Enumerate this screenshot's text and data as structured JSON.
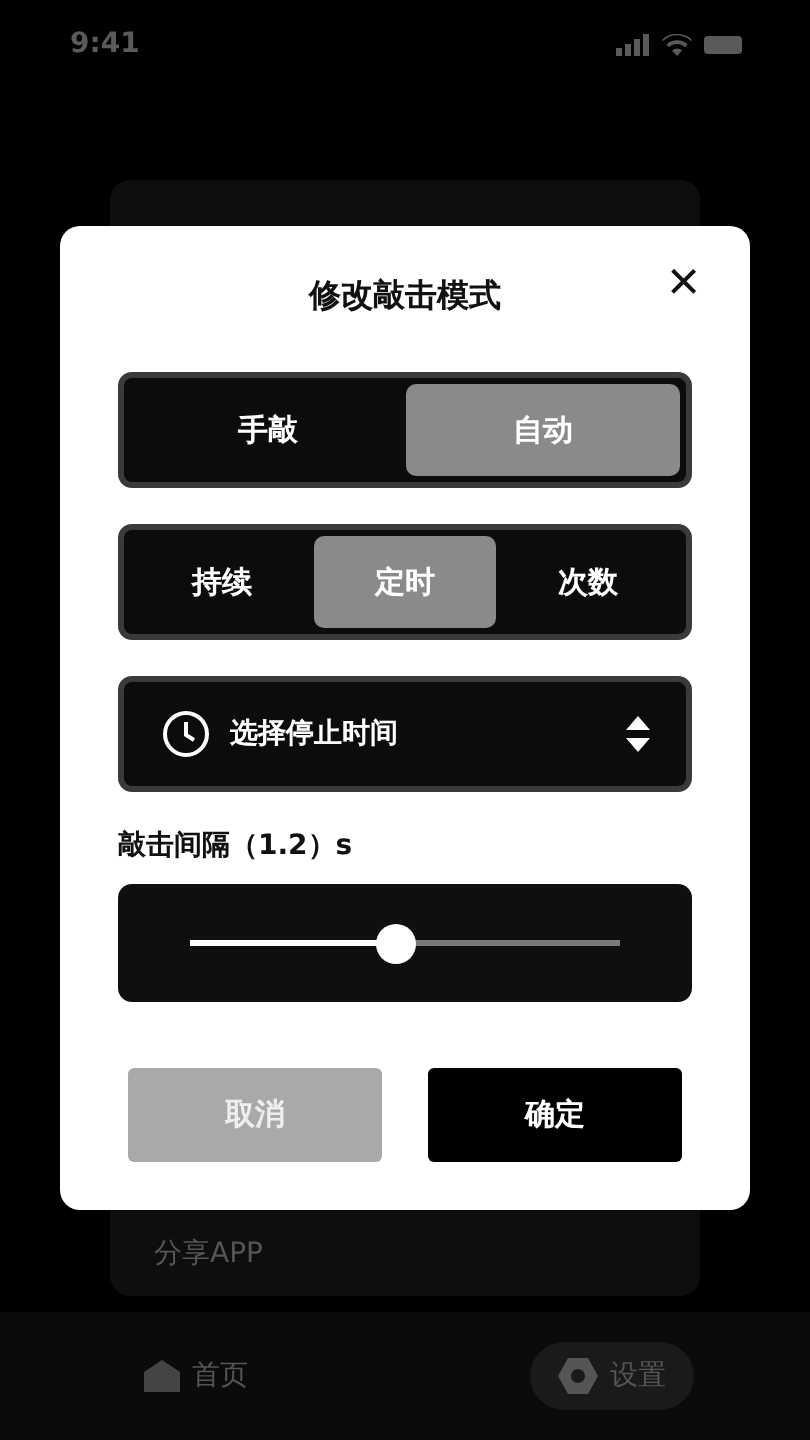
{
  "status_bar": {
    "time": "9:41"
  },
  "background_list": {
    "items": [
      "分享APP"
    ]
  },
  "bottom_nav": [
    {
      "label": "首页",
      "kind": "home",
      "selected": false
    },
    {
      "label": "设置",
      "kind": "settings",
      "selected": true
    }
  ],
  "dialog": {
    "title": "修改敲击模式",
    "close": "×",
    "mode_tabs": [
      {
        "label": "手敲",
        "selected": false
      },
      {
        "label": "自动",
        "selected": true
      }
    ],
    "type_tabs": [
      {
        "label": "持续",
        "selected": false
      },
      {
        "label": "定时",
        "selected": true
      },
      {
        "label": "次数",
        "selected": false
      }
    ],
    "stop_time_select": {
      "placeholder": "选择停止时间"
    },
    "interval_label": "敲击间隔（1.2）s",
    "interval_slider": {
      "level": 0.48
    },
    "buttons": [
      {
        "label": "取消",
        "kind": "cancel"
      },
      {
        "label": "确定",
        "kind": "confirm"
      }
    ]
  }
}
